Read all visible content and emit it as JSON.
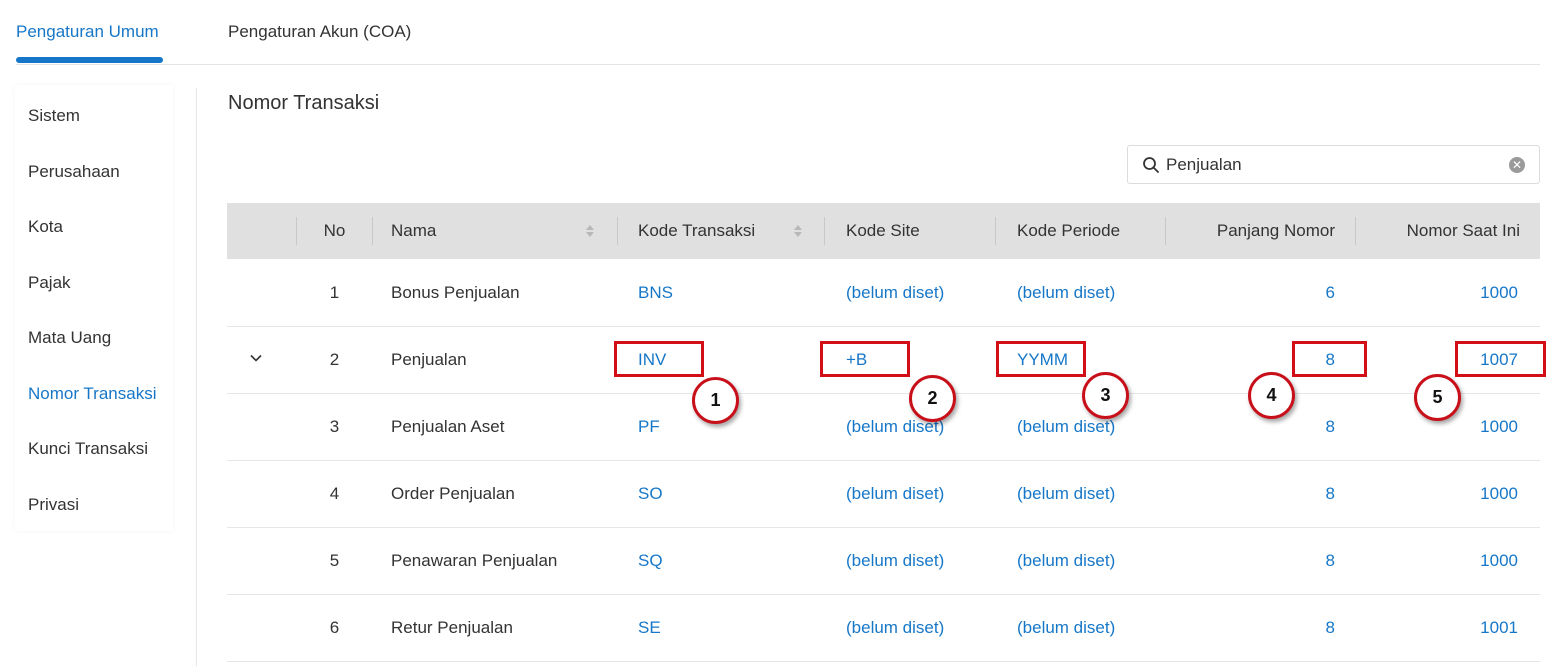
{
  "tabs": [
    {
      "label": "Pengaturan Umum",
      "active": true
    },
    {
      "label": "Pengaturan Akun (COA)",
      "active": false
    }
  ],
  "sidebar": {
    "items": [
      {
        "label": "Sistem"
      },
      {
        "label": "Perusahaan"
      },
      {
        "label": "Kota"
      },
      {
        "label": "Pajak"
      },
      {
        "label": "Mata Uang"
      },
      {
        "label": "Nomor Transaksi",
        "active": true
      },
      {
        "label": "Kunci Transaksi"
      },
      {
        "label": "Privasi"
      }
    ]
  },
  "main": {
    "title": "Nomor Transaksi",
    "search": {
      "value": "Penjualan",
      "icon": "search-icon",
      "clear_icon": "clear-icon"
    }
  },
  "table": {
    "columns": [
      "No",
      "Nama",
      "Kode Transaksi",
      "Kode Site",
      "Kode Periode",
      "Panjang Nomor",
      "Nomor Saat Ini"
    ],
    "rows": [
      {
        "no": "1",
        "nama": "Bonus Penjualan",
        "kode": "BNS",
        "site": "(belum diset)",
        "periode": "(belum diset)",
        "panjang": "6",
        "nomor": "1000"
      },
      {
        "no": "2",
        "nama": "Penjualan",
        "kode": "INV",
        "site": "+B",
        "periode": "YYMM",
        "panjang": "8",
        "nomor": "1007"
      },
      {
        "no": "3",
        "nama": "Penjualan Aset",
        "kode": "PF",
        "site": "(belum diset)",
        "periode": "(belum diset)",
        "panjang": "8",
        "nomor": "1000"
      },
      {
        "no": "4",
        "nama": "Order Penjualan",
        "kode": "SO",
        "site": "(belum diset)",
        "periode": "(belum diset)",
        "panjang": "8",
        "nomor": "1000"
      },
      {
        "no": "5",
        "nama": "Penawaran Penjualan",
        "kode": "SQ",
        "site": "(belum diset)",
        "periode": "(belum diset)",
        "panjang": "8",
        "nomor": "1000"
      },
      {
        "no": "6",
        "nama": "Retur Penjualan",
        "kode": "SE",
        "site": "(belum diset)",
        "periode": "(belum diset)",
        "panjang": "8",
        "nomor": "1001"
      }
    ]
  },
  "annotations": [
    "1",
    "2",
    "3",
    "4",
    "5"
  ],
  "colors": {
    "accent": "#1677c8",
    "annotation": "#d20f16",
    "header_bg": "#e0e0e0"
  }
}
